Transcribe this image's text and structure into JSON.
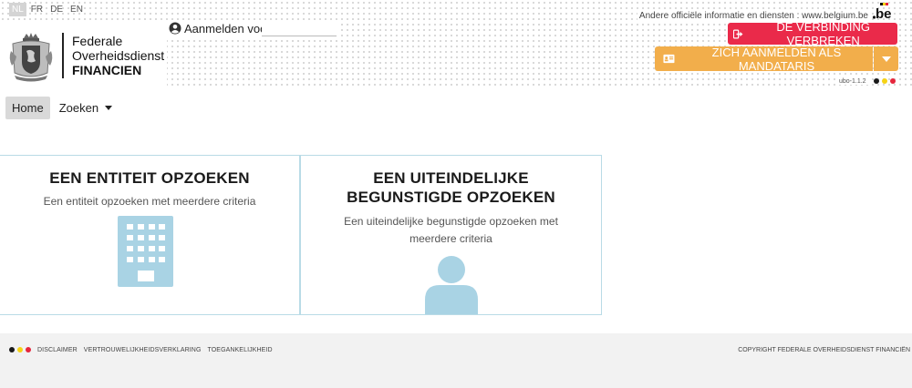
{
  "languages": [
    {
      "code": "NL",
      "active": true
    },
    {
      "code": "FR",
      "active": false
    },
    {
      "code": "DE",
      "active": false
    },
    {
      "code": "EN",
      "active": false
    }
  ],
  "logo": {
    "line1": "Federale",
    "line2": "Overheidsdienst",
    "line3": "FINANCIEN"
  },
  "login": {
    "label": "Aanmelden voor",
    "value": ""
  },
  "header": {
    "belgium_text": "Andere officiële informatie en diensten : www.belgium.be",
    "be_logo": "be",
    "disconnect_label": "DE VERBINDING VERBREKEN",
    "mandataris_label": "ZICH AANMELDEN ALS MANDATARIS",
    "version": "ubo-1.1.2"
  },
  "colors": {
    "disconnect": "#ea2a4a",
    "mandataris": "#f2ae4b",
    "flag_black": "#1a1a1a",
    "flag_yellow": "#f6d316",
    "flag_red": "#e5263c",
    "card_border": "#b9dbe6",
    "icon_blue": "#a9d3e4"
  },
  "icons": {
    "disconnect": "sign-out-icon",
    "mandataris": "id-card-icon",
    "login": "user-circle-icon",
    "card1": "building-icon",
    "card2": "person-icon"
  },
  "nav": {
    "home": "Home",
    "search": "Zoeken"
  },
  "cards": [
    {
      "title": "EEN ENTITEIT OPZOEKEN",
      "description": "Een entiteit opzoeken met meerdere criteria"
    },
    {
      "title": "EEN UITEINDELIJKE BEGUNSTIGDE OPZOEKEN",
      "description": "Een uiteindelijke begunstigde opzoeken met meerdere criteria"
    }
  ],
  "footer": {
    "links": [
      "DISCLAIMER",
      "VERTROUWELIJKHEIDSVERKLARING",
      "TOEGANKELIJKHEID"
    ],
    "copyright": "COPYRIGHT FEDERALE OVERHEIDSDIENST FINANCIËN"
  }
}
